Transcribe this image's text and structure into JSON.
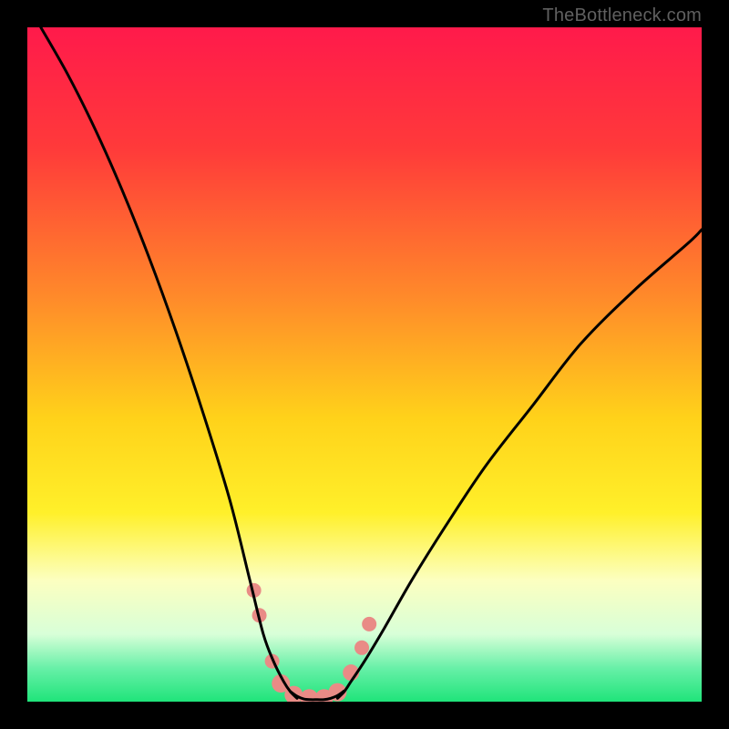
{
  "watermark": "TheBottleneck.com",
  "chart_data": {
    "type": "line",
    "title": "",
    "xlabel": "",
    "ylabel": "",
    "xlim": [
      0,
      100
    ],
    "ylim": [
      0,
      100
    ],
    "gradient_stops": [
      {
        "offset": 0,
        "color": "#ff1a4b"
      },
      {
        "offset": 0.18,
        "color": "#ff3a3a"
      },
      {
        "offset": 0.4,
        "color": "#ff8a2a"
      },
      {
        "offset": 0.58,
        "color": "#ffd21a"
      },
      {
        "offset": 0.72,
        "color": "#fff02a"
      },
      {
        "offset": 0.82,
        "color": "#fcffc0"
      },
      {
        "offset": 0.9,
        "color": "#d8ffd8"
      },
      {
        "offset": 0.95,
        "color": "#68f0a8"
      },
      {
        "offset": 1.0,
        "color": "#1fe47a"
      }
    ],
    "series": [
      {
        "name": "left-curve",
        "x": [
          2,
          6,
          10,
          14,
          18,
          22,
          26,
          30,
          33,
          35,
          36.5,
          38,
          39,
          40
        ],
        "y": [
          100,
          93,
          85,
          76,
          66,
          55,
          43,
          30,
          18,
          10,
          6,
          3,
          1.5,
          0.5
        ]
      },
      {
        "name": "right-curve",
        "x": [
          46,
          47,
          48,
          50,
          53,
          57,
          62,
          68,
          75,
          82,
          90,
          98,
          100
        ],
        "y": [
          0.5,
          1.5,
          3,
          6,
          11,
          18,
          26,
          35,
          44,
          53,
          61,
          68,
          70
        ]
      },
      {
        "name": "valley-floor",
        "x": [
          39,
          40,
          41,
          42,
          43,
          44,
          45,
          46,
          47
        ],
        "y": [
          1.5,
          0.8,
          0.4,
          0.3,
          0.3,
          0.3,
          0.5,
          0.9,
          1.6
        ]
      }
    ],
    "markers": {
      "name": "valley-markers",
      "color": "#e98b86",
      "points": [
        {
          "x": 33.6,
          "y": 16.5,
          "r": 8
        },
        {
          "x": 34.4,
          "y": 12.8,
          "r": 8
        },
        {
          "x": 36.3,
          "y": 6.0,
          "r": 8
        },
        {
          "x": 37.6,
          "y": 2.7,
          "r": 10
        },
        {
          "x": 39.5,
          "y": 1.0,
          "r": 10
        },
        {
          "x": 41.8,
          "y": 0.5,
          "r": 10
        },
        {
          "x": 44.0,
          "y": 0.5,
          "r": 10
        },
        {
          "x": 46.0,
          "y": 1.4,
          "r": 10
        },
        {
          "x": 48.0,
          "y": 4.3,
          "r": 9
        },
        {
          "x": 49.6,
          "y": 8.0,
          "r": 8
        },
        {
          "x": 50.7,
          "y": 11.5,
          "r": 8
        }
      ]
    }
  }
}
